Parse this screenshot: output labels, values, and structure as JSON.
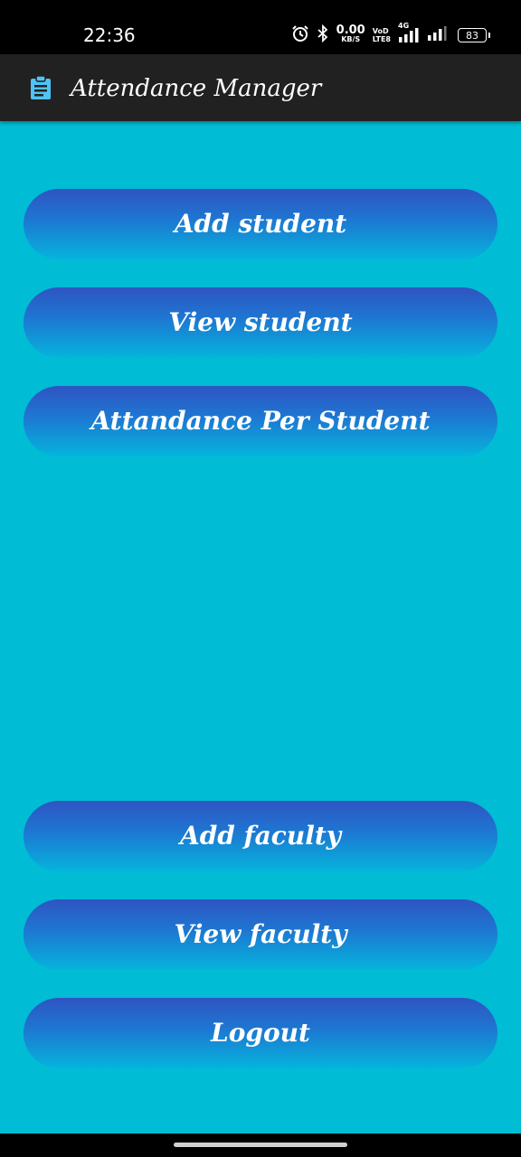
{
  "status_bar": {
    "time": "22:36",
    "net_speed_value": "0.00",
    "net_speed_unit": "KB/S",
    "volte_top": "VoD",
    "volte_bottom": "LTE8",
    "network_type": "4G",
    "battery_level": "83",
    "icons": [
      "alarm-icon",
      "bluetooth-icon",
      "signal-icon",
      "signal-icon",
      "battery-icon"
    ]
  },
  "app_bar": {
    "title": "Attendance Manager",
    "icon": "clipboard-icon",
    "accent_color": "#4fc3f7"
  },
  "buttons": {
    "add_student": "Add student",
    "view_student": "View student",
    "attendance_per_student": "Attandance Per Student",
    "add_faculty": "Add faculty",
    "view_faculty": "View faculty",
    "logout": "Logout"
  },
  "colors": {
    "background": "#00bcd4",
    "app_bar": "#212121",
    "button_gradient_top": "#2f54c2",
    "button_gradient_bottom": "#05b4dc"
  }
}
